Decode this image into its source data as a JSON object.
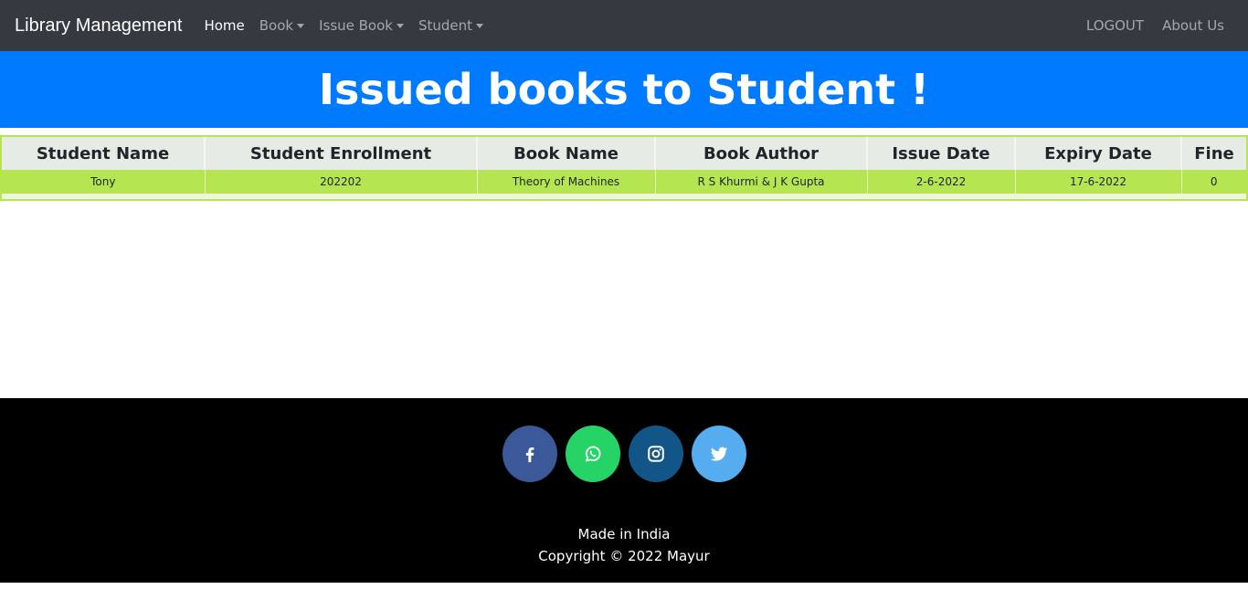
{
  "navbar": {
    "brand": "Library Management",
    "items": [
      {
        "label": "Home",
        "active": true,
        "dropdown": false
      },
      {
        "label": "Book",
        "active": false,
        "dropdown": true
      },
      {
        "label": "Issue Book",
        "active": false,
        "dropdown": true
      },
      {
        "label": "Student",
        "active": false,
        "dropdown": true
      }
    ],
    "right_items": [
      {
        "label": "LOGOUT"
      },
      {
        "label": "About Us"
      }
    ]
  },
  "banner": {
    "title": "Issued books to Student !",
    "color": "#007bff"
  },
  "table": {
    "headers": [
      "Student Name",
      "Student Enrollment",
      "Book Name",
      "Book Author",
      "Issue Date",
      "Expiry Date",
      "Fine"
    ],
    "rows": [
      [
        "Tony",
        "202202",
        "Theory of Machines",
        "R S Khurmi & J K Gupta",
        "2-6-2022",
        "17-6-2022",
        "0"
      ]
    ],
    "row_color": "#b5e651"
  },
  "footer": {
    "socials": [
      {
        "icon": "facebook-icon",
        "color": "#3b5998"
      },
      {
        "icon": "whatsapp-icon",
        "color": "#25d366"
      },
      {
        "icon": "instagram-icon",
        "color": "#125688"
      },
      {
        "icon": "twitter-icon",
        "color": "#55acee"
      }
    ],
    "made_in": "Made in India",
    "copyright": "Copyright © 2022 Mayur"
  }
}
